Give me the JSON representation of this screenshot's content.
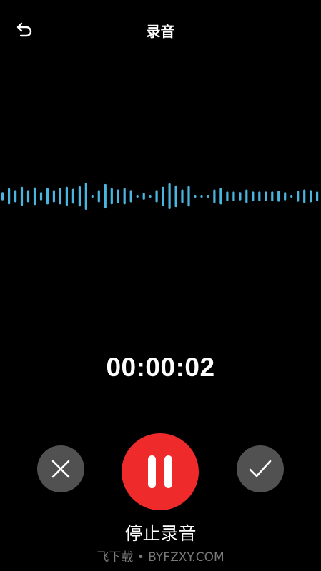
{
  "header": {
    "title": "录音",
    "back_icon": "back-arrow-icon"
  },
  "waveform": {
    "color": "#4ab6df",
    "levels": [
      0.3,
      0.6,
      0.45,
      0.7,
      0.45,
      0.65,
      0.3,
      0.6,
      0.45,
      0.6,
      0.7,
      0.55,
      0.75,
      1.0,
      0.1,
      0.45,
      0.9,
      0.6,
      0.5,
      0.6,
      0.45,
      0.1,
      0.25,
      0.1,
      0.45,
      0.7,
      0.95,
      0.8,
      0.5,
      0.75,
      0.1,
      0.1,
      0.1,
      0.5,
      0.6,
      0.35,
      0.35,
      0.3,
      0.5,
      0.35,
      0.35,
      0.35,
      0.35,
      0.4,
      0.3,
      0.1,
      0.4,
      0.5,
      0.45,
      0.35
    ]
  },
  "timer": "00:00:02",
  "controls": {
    "cancel_icon": "close-icon",
    "pause_icon": "pause-icon",
    "confirm_icon": "check-icon",
    "pause_color": "#ee2a2a",
    "secondary_color": "#515151"
  },
  "status_label": "停止录音",
  "watermark": "飞下载 • BYFZXY.COM"
}
